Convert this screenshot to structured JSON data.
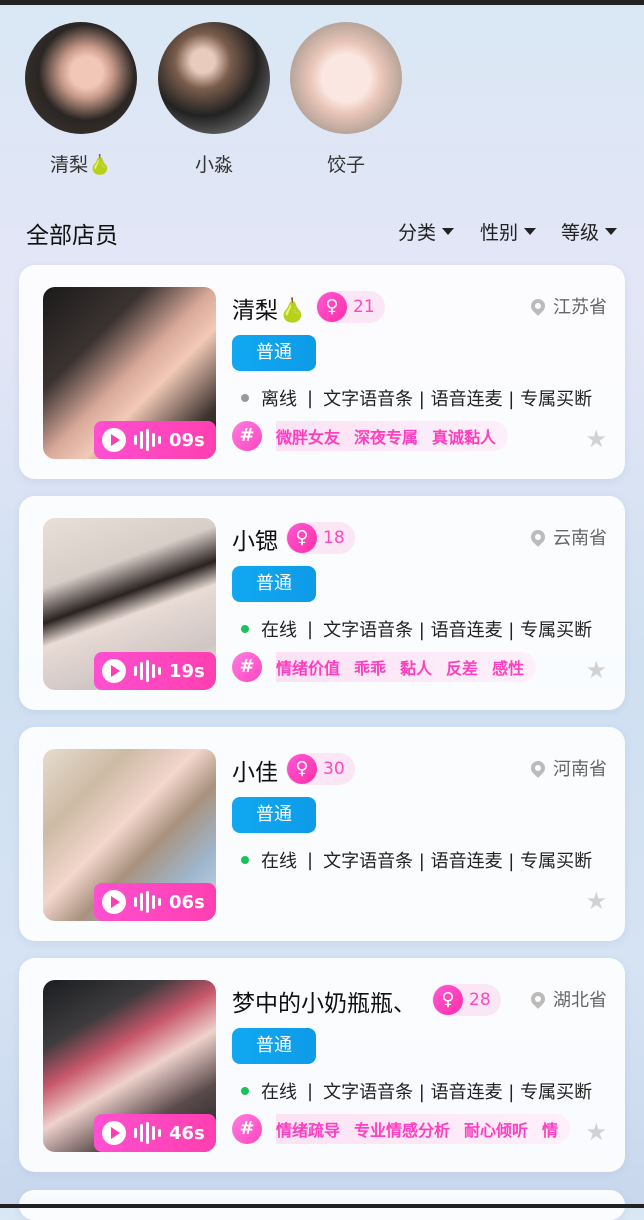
{
  "stories": [
    {
      "name": "清梨🍐"
    },
    {
      "name": "小淼"
    },
    {
      "name": "饺子"
    }
  ],
  "section": {
    "title": "全部店员",
    "filters": [
      "分类",
      "性别",
      "等级"
    ]
  },
  "cards": [
    {
      "name": "清梨🍐",
      "level": "21",
      "location": "江苏省",
      "badge": "普通",
      "status": "离线",
      "status_color": "#999999",
      "services": "文字语音条 | 语音连麦 | 专属买断",
      "duration": "09s",
      "tags": [
        "微胖女友",
        "深夜专属",
        "真诚黏人"
      ]
    },
    {
      "name": "小锶",
      "level": "18",
      "location": "云南省",
      "badge": "普通",
      "status": "在线",
      "status_color": "#19c25a",
      "services": "文字语音条 | 语音连麦 | 专属买断",
      "duration": "19s",
      "tags": [
        "情绪价值",
        "乖乖",
        "黏人",
        "反差",
        "感性"
      ]
    },
    {
      "name": "小佳",
      "level": "30",
      "location": "河南省",
      "badge": "普通",
      "status": "在线",
      "status_color": "#19c25a",
      "services": "文字语音条 | 语音连麦 | 专属买断",
      "duration": "06s",
      "tags": []
    },
    {
      "name": "梦中的小奶瓶瓶、",
      "level": "28",
      "location": "湖北省",
      "badge": "普通",
      "status": "在线",
      "status_color": "#19c25a",
      "services": "文字语音条 | 语音连麦 | 专属买断",
      "duration": "46s",
      "tags": [
        "情绪疏导",
        "专业情感分析",
        "耐心倾听",
        "情"
      ]
    }
  ],
  "icons": {
    "voice": "play-icon",
    "favorite": "star-icon",
    "location": "pin-icon",
    "gender": "female-icon",
    "tag": "hash-icon"
  }
}
